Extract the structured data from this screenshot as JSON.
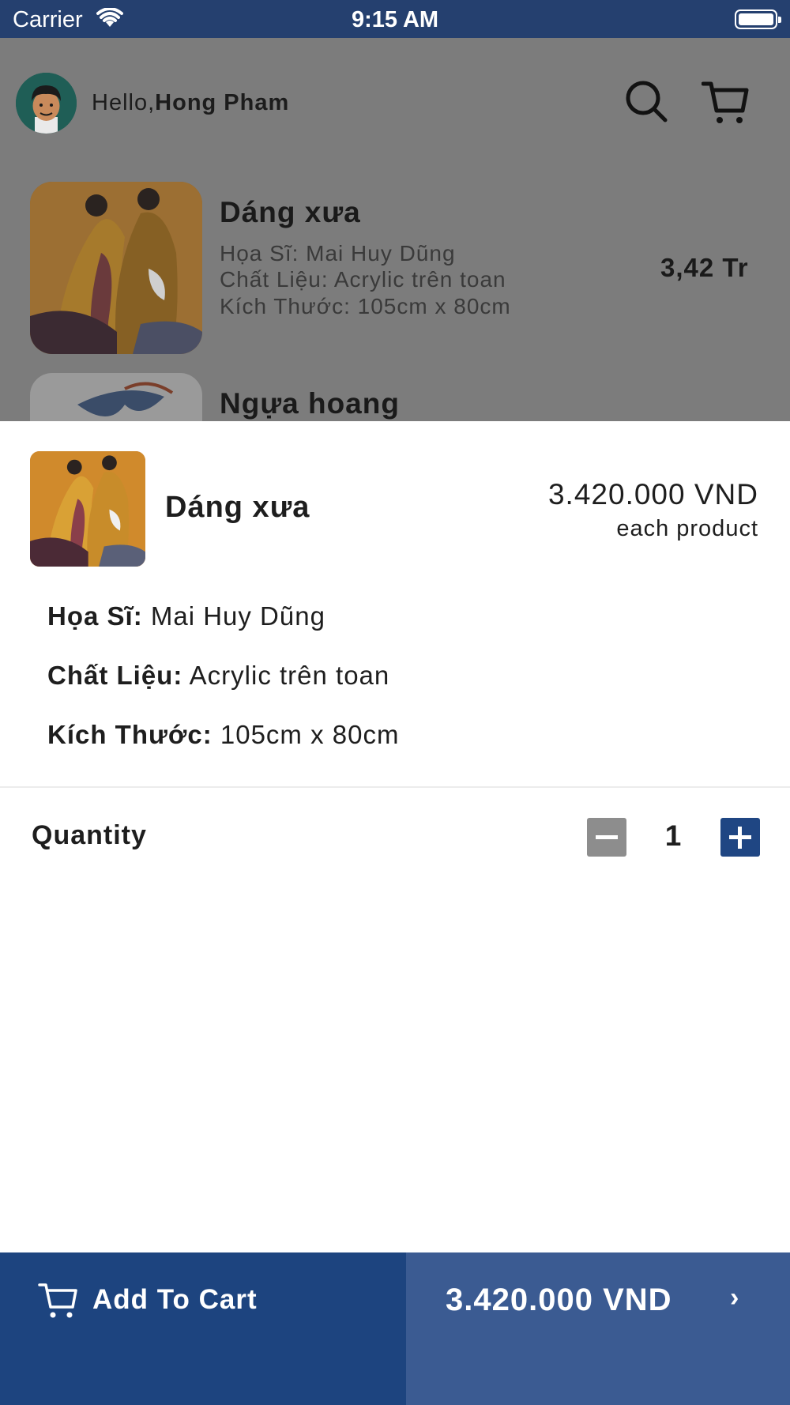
{
  "status_bar": {
    "carrier": "Carrier",
    "time": "9:15 AM"
  },
  "header": {
    "greeting": "Hello,",
    "user_name": "Hong Pham"
  },
  "products": [
    {
      "title": "Dáng xưa",
      "artist": "Họa Sĩ: Mai Huy Dũng",
      "material": "Chất Liệu: Acrylic trên toan",
      "size": "Kích Thước: 105cm x 80cm",
      "price": "3,42 Tr"
    },
    {
      "title": "Ngựa hoang"
    }
  ],
  "sheet": {
    "title": "Dáng xưa",
    "price": "3.420.000 VND",
    "price_note": "each product",
    "artist_label": "Họa Sĩ:",
    "artist_value": " Mai Huy Dũng",
    "material_label": "Chất Liệu:",
    "material_value": " Acrylic trên toan",
    "size_label": "Kích Thước:",
    "size_value": " 105cm x 80cm",
    "quantity_label": "Quantity",
    "quantity": "1"
  },
  "bottom_bar": {
    "add_to_cart": "Add To Cart",
    "total": "3.420.000 VND",
    "chevron": "›"
  },
  "colors": {
    "primary": "#1d447f",
    "secondary": "#3b5b92",
    "status_bar": "#25406f",
    "overlay": "#7c7c7c",
    "minus_button": "#8d8d8d"
  },
  "icons": [
    "wifi-icon",
    "battery-icon",
    "avatar",
    "search-icon",
    "cart-icon",
    "minus-icon",
    "plus-icon",
    "chevron-right-icon"
  ]
}
